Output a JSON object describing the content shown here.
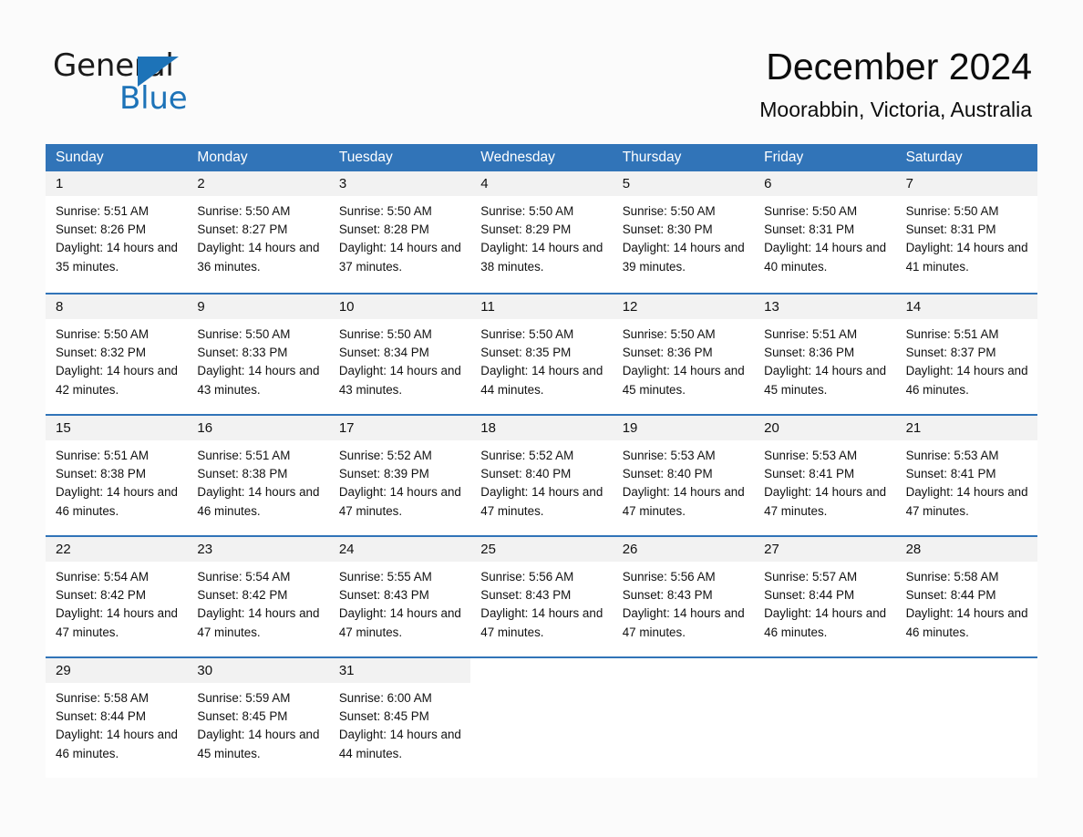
{
  "brand": {
    "word_one": "General",
    "word_two": "Blue",
    "triangle_icon": "triangle-logo-icon",
    "accent_color": "#1D73B8"
  },
  "header": {
    "title": "December 2024",
    "subtitle": "Moorabbin, Victoria, Australia"
  },
  "calendar": {
    "header_bg": "#3174B8",
    "daynum_bg": "#F2F2F2",
    "weekdays": [
      "Sunday",
      "Monday",
      "Tuesday",
      "Wednesday",
      "Thursday",
      "Friday",
      "Saturday"
    ],
    "weeks": [
      [
        {
          "day": "1",
          "sunrise": "Sunrise: 5:51 AM",
          "sunset": "Sunset: 8:26 PM",
          "daylight": "Daylight: 14 hours and 35 minutes."
        },
        {
          "day": "2",
          "sunrise": "Sunrise: 5:50 AM",
          "sunset": "Sunset: 8:27 PM",
          "daylight": "Daylight: 14 hours and 36 minutes."
        },
        {
          "day": "3",
          "sunrise": "Sunrise: 5:50 AM",
          "sunset": "Sunset: 8:28 PM",
          "daylight": "Daylight: 14 hours and 37 minutes."
        },
        {
          "day": "4",
          "sunrise": "Sunrise: 5:50 AM",
          "sunset": "Sunset: 8:29 PM",
          "daylight": "Daylight: 14 hours and 38 minutes."
        },
        {
          "day": "5",
          "sunrise": "Sunrise: 5:50 AM",
          "sunset": "Sunset: 8:30 PM",
          "daylight": "Daylight: 14 hours and 39 minutes."
        },
        {
          "day": "6",
          "sunrise": "Sunrise: 5:50 AM",
          "sunset": "Sunset: 8:31 PM",
          "daylight": "Daylight: 14 hours and 40 minutes."
        },
        {
          "day": "7",
          "sunrise": "Sunrise: 5:50 AM",
          "sunset": "Sunset: 8:31 PM",
          "daylight": "Daylight: 14 hours and 41 minutes."
        }
      ],
      [
        {
          "day": "8",
          "sunrise": "Sunrise: 5:50 AM",
          "sunset": "Sunset: 8:32 PM",
          "daylight": "Daylight: 14 hours and 42 minutes."
        },
        {
          "day": "9",
          "sunrise": "Sunrise: 5:50 AM",
          "sunset": "Sunset: 8:33 PM",
          "daylight": "Daylight: 14 hours and 43 minutes."
        },
        {
          "day": "10",
          "sunrise": "Sunrise: 5:50 AM",
          "sunset": "Sunset: 8:34 PM",
          "daylight": "Daylight: 14 hours and 43 minutes."
        },
        {
          "day": "11",
          "sunrise": "Sunrise: 5:50 AM",
          "sunset": "Sunset: 8:35 PM",
          "daylight": "Daylight: 14 hours and 44 minutes."
        },
        {
          "day": "12",
          "sunrise": "Sunrise: 5:50 AM",
          "sunset": "Sunset: 8:36 PM",
          "daylight": "Daylight: 14 hours and 45 minutes."
        },
        {
          "day": "13",
          "sunrise": "Sunrise: 5:51 AM",
          "sunset": "Sunset: 8:36 PM",
          "daylight": "Daylight: 14 hours and 45 minutes."
        },
        {
          "day": "14",
          "sunrise": "Sunrise: 5:51 AM",
          "sunset": "Sunset: 8:37 PM",
          "daylight": "Daylight: 14 hours and 46 minutes."
        }
      ],
      [
        {
          "day": "15",
          "sunrise": "Sunrise: 5:51 AM",
          "sunset": "Sunset: 8:38 PM",
          "daylight": "Daylight: 14 hours and 46 minutes."
        },
        {
          "day": "16",
          "sunrise": "Sunrise: 5:51 AM",
          "sunset": "Sunset: 8:38 PM",
          "daylight": "Daylight: 14 hours and 46 minutes."
        },
        {
          "day": "17",
          "sunrise": "Sunrise: 5:52 AM",
          "sunset": "Sunset: 8:39 PM",
          "daylight": "Daylight: 14 hours and 47 minutes."
        },
        {
          "day": "18",
          "sunrise": "Sunrise: 5:52 AM",
          "sunset": "Sunset: 8:40 PM",
          "daylight": "Daylight: 14 hours and 47 minutes."
        },
        {
          "day": "19",
          "sunrise": "Sunrise: 5:53 AM",
          "sunset": "Sunset: 8:40 PM",
          "daylight": "Daylight: 14 hours and 47 minutes."
        },
        {
          "day": "20",
          "sunrise": "Sunrise: 5:53 AM",
          "sunset": "Sunset: 8:41 PM",
          "daylight": "Daylight: 14 hours and 47 minutes."
        },
        {
          "day": "21",
          "sunrise": "Sunrise: 5:53 AM",
          "sunset": "Sunset: 8:41 PM",
          "daylight": "Daylight: 14 hours and 47 minutes."
        }
      ],
      [
        {
          "day": "22",
          "sunrise": "Sunrise: 5:54 AM",
          "sunset": "Sunset: 8:42 PM",
          "daylight": "Daylight: 14 hours and 47 minutes."
        },
        {
          "day": "23",
          "sunrise": "Sunrise: 5:54 AM",
          "sunset": "Sunset: 8:42 PM",
          "daylight": "Daylight: 14 hours and 47 minutes."
        },
        {
          "day": "24",
          "sunrise": "Sunrise: 5:55 AM",
          "sunset": "Sunset: 8:43 PM",
          "daylight": "Daylight: 14 hours and 47 minutes."
        },
        {
          "day": "25",
          "sunrise": "Sunrise: 5:56 AM",
          "sunset": "Sunset: 8:43 PM",
          "daylight": "Daylight: 14 hours and 47 minutes."
        },
        {
          "day": "26",
          "sunrise": "Sunrise: 5:56 AM",
          "sunset": "Sunset: 8:43 PM",
          "daylight": "Daylight: 14 hours and 47 minutes."
        },
        {
          "day": "27",
          "sunrise": "Sunrise: 5:57 AM",
          "sunset": "Sunset: 8:44 PM",
          "daylight": "Daylight: 14 hours and 46 minutes."
        },
        {
          "day": "28",
          "sunrise": "Sunrise: 5:58 AM",
          "sunset": "Sunset: 8:44 PM",
          "daylight": "Daylight: 14 hours and 46 minutes."
        }
      ],
      [
        {
          "day": "29",
          "sunrise": "Sunrise: 5:58 AM",
          "sunset": "Sunset: 8:44 PM",
          "daylight": "Daylight: 14 hours and 46 minutes."
        },
        {
          "day": "30",
          "sunrise": "Sunrise: 5:59 AM",
          "sunset": "Sunset: 8:45 PM",
          "daylight": "Daylight: 14 hours and 45 minutes."
        },
        {
          "day": "31",
          "sunrise": "Sunrise: 6:00 AM",
          "sunset": "Sunset: 8:45 PM",
          "daylight": "Daylight: 14 hours and 44 minutes."
        },
        {
          "day": "",
          "sunrise": "",
          "sunset": "",
          "daylight": ""
        },
        {
          "day": "",
          "sunrise": "",
          "sunset": "",
          "daylight": ""
        },
        {
          "day": "",
          "sunrise": "",
          "sunset": "",
          "daylight": ""
        },
        {
          "day": "",
          "sunrise": "",
          "sunset": "",
          "daylight": ""
        }
      ]
    ]
  }
}
